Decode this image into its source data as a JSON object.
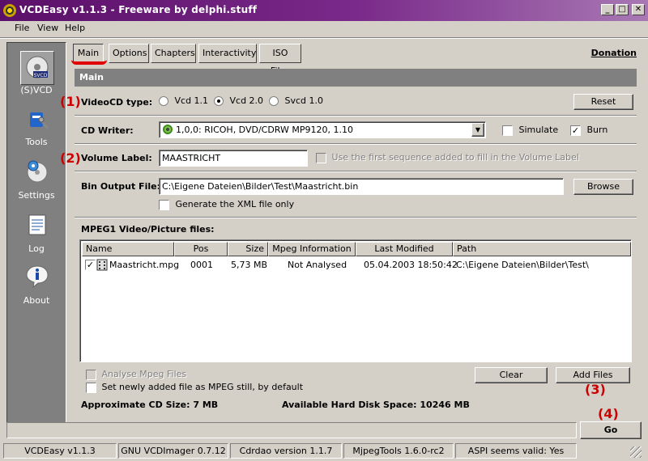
{
  "window": {
    "title": "VCDEasy v1.1.3 - Freeware by delphi.stuff"
  },
  "menu": {
    "file": "File",
    "view": "View",
    "help": "Help"
  },
  "sidebar": {
    "items": [
      {
        "label": "(S)VCD",
        "icon": "svcd-disc-icon"
      },
      {
        "label": "Tools",
        "icon": "tools-icon"
      },
      {
        "label": "Settings",
        "icon": "settings-icon"
      },
      {
        "label": "Log",
        "icon": "log-icon"
      },
      {
        "label": "About",
        "icon": "info-icon"
      }
    ]
  },
  "tabs": [
    "Main",
    "Options",
    "Chapters",
    "Interactivity",
    "ISO Files"
  ],
  "donation": "Donation",
  "section_title": "Main",
  "annotations": [
    "(1)",
    "(2)",
    "(3)",
    "(4)"
  ],
  "videocd": {
    "label": "VideoCD type:",
    "options": [
      "Vcd 1.1",
      "Vcd 2.0",
      "Svcd 1.0"
    ],
    "selected": "Vcd 2.0",
    "reset": "Reset"
  },
  "writer": {
    "label": "CD Writer:",
    "value": "1,0,0: RICOH, DVD/CDRW MP9120, 1.10",
    "simulate": "Simulate",
    "burn": "Burn",
    "burn_checked": true,
    "simulate_checked": false
  },
  "volume": {
    "label": "Volume Label:",
    "value": "MAASTRICHT",
    "use_first": "Use the first sequence added to fill in the Volume Label"
  },
  "bin": {
    "label": "Bin Output File:",
    "value": "C:\\Eigene Dateien\\Bilder\\Test\\Maastricht.bin",
    "browse": "Browse",
    "xml_only": "Generate the XML file only"
  },
  "files": {
    "label": "MPEG1 Video/Picture files:",
    "columns": [
      "Name",
      "Pos",
      "Size",
      "Mpeg Information",
      "Last Modified",
      "Path"
    ],
    "rows": [
      {
        "name": "Maastricht.mpg",
        "pos": "0001",
        "size": "5,73 MB",
        "info": "Not Analysed",
        "modified": "05.04.2003 18:50:42",
        "path": "C:\\Eigene Dateien\\Bilder\\Test\\"
      }
    ],
    "analyse": "Analyse Mpeg Files",
    "set_still": "Set newly added file as MPEG still, by default",
    "clear": "Clear",
    "add": "Add Files"
  },
  "summary": {
    "cd_size": "Approximate CD Size:  7 MB",
    "disk_space": "Available Hard Disk Space:  10246 MB"
  },
  "go": "Go",
  "status": [
    "VCDEasy v1.1.3",
    "GNU VCDImager 0.7.12",
    "Cdrdao version 1.1.7",
    "MjpegTools 1.6.0-rc2",
    "ASPI seems valid: Yes"
  ],
  "colors": {
    "title_start": "#5a0f68",
    "title_end": "#a878b4",
    "annotation": "#cc0000"
  }
}
